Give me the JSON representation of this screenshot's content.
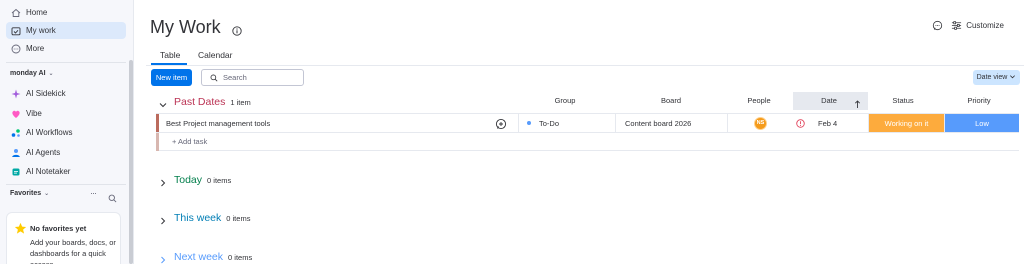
{
  "sidebar": {
    "items": [
      {
        "label": "Home",
        "icon": "home-icon"
      },
      {
        "label": "My work",
        "icon": "calendar-check-icon",
        "active": true
      },
      {
        "label": "More",
        "icon": "more-circle-icon"
      }
    ],
    "workspace_label": "monday AI",
    "ai_items": [
      {
        "label": "AI Sidekick",
        "icon": "sidekick-icon"
      },
      {
        "label": "Vibe",
        "icon": "vibe-icon"
      },
      {
        "label": "AI Workflows",
        "icon": "workflows-icon"
      },
      {
        "label": "AI Agents",
        "icon": "agents-icon"
      },
      {
        "label": "AI Notetaker",
        "icon": "notetaker-icon"
      }
    ],
    "favorites_label": "Favorites",
    "favorites_empty_title": "No favorites yet",
    "favorites_empty_text": "Add your boards, docs, or dashboards for a quick access"
  },
  "header": {
    "title": "My Work",
    "customize_label": "Customize"
  },
  "tabs": [
    {
      "label": "Table",
      "active": true
    },
    {
      "label": "Calendar",
      "active": false
    }
  ],
  "toolbar": {
    "new_item_label": "New item",
    "search_placeholder": "Search",
    "date_view_label": "Date view"
  },
  "columns": {
    "group": "Group",
    "board": "Board",
    "people": "People",
    "date": "Date",
    "status": "Status",
    "priority": "Priority"
  },
  "groups": [
    {
      "name": "Past Dates",
      "count": "1 item",
      "color": "#bb3354"
    },
    {
      "name": "Today",
      "count": "0 items",
      "color": "#037f4c"
    },
    {
      "name": "This week",
      "count": "0 items",
      "color": "#007eb5"
    },
    {
      "name": "Next week",
      "count": "0 items",
      "color": "#579bfc"
    }
  ],
  "rows": [
    {
      "name": "Best Project management tools",
      "group": "To-Do",
      "board": "Content board 2026",
      "people": "NS",
      "date": "Feb 4",
      "status": "Working on it",
      "priority": "Low"
    }
  ],
  "add_task_label": "+ Add task",
  "colors": {
    "accent": "#0073ea",
    "status_working": "#fdab3d",
    "priority_low": "#579bfc"
  }
}
